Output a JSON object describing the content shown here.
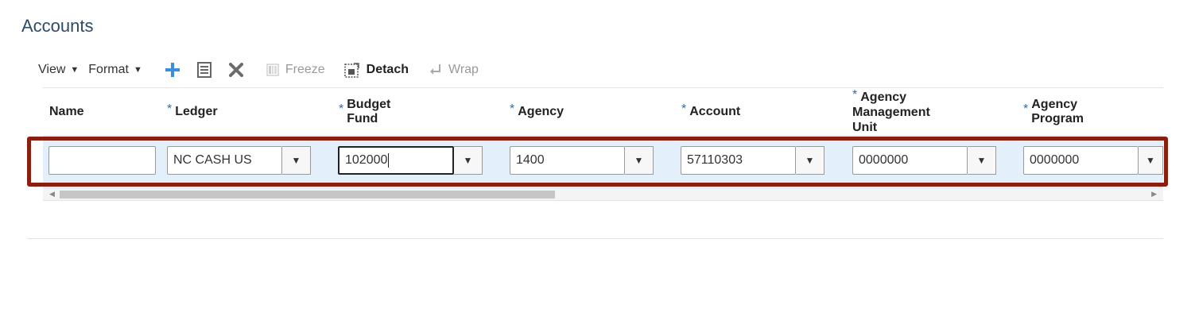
{
  "page": {
    "title": "Accounts"
  },
  "toolbar": {
    "view_label": "View",
    "format_label": "Format",
    "freeze_label": "Freeze",
    "detach_label": "Detach",
    "wrap_label": "Wrap"
  },
  "columns": {
    "name": "Name",
    "ledger": "Ledger",
    "budget_fund": "Budget Fund",
    "agency": "Agency",
    "account": "Account",
    "agency_mgmt_unit_line1": "Agency Management",
    "agency_mgmt_unit_line2": "Unit",
    "agency_program": "Agency Program"
  },
  "row": {
    "name": "",
    "ledger": "NC CASH US",
    "budget_fund": "102000",
    "agency": "1400",
    "account": "57110303",
    "agency_mgmt_unit": "0000000",
    "agency_program": "0000000"
  },
  "colors": {
    "highlight": "#8b1f0f",
    "row_bg": "#e3effa",
    "add_icon": "#3b8de0",
    "required": "#1a6fd1"
  }
}
